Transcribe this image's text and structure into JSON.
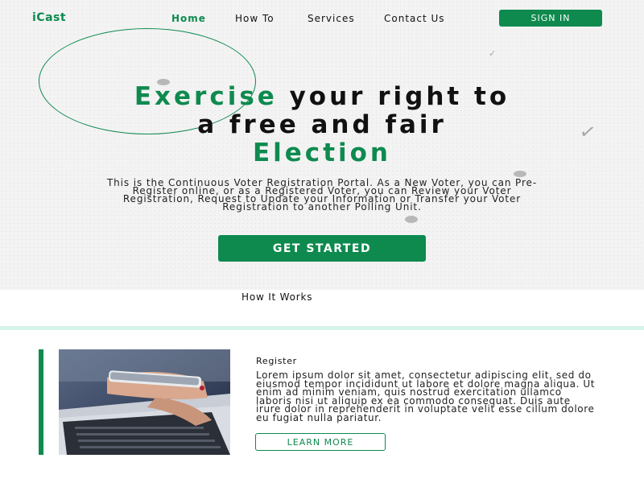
{
  "header": {
    "logo": "iCast",
    "nav": [
      "Home",
      "How To",
      "Services",
      "Contact Us"
    ],
    "active_nav": "Home",
    "signin_label": "SIGN IN"
  },
  "hero": {
    "headline_green_1": "Exercise",
    "headline_dark_1": " your right to",
    "headline_dark_2": "a free and fair",
    "headline_green_2": "Election",
    "description": "This is the Continuous Voter Registration Portal. As a New Voter, you can Pre-Register online, or as a Registered Voter, you can Review your Voter Registration, Request to Update your Information or Transfer your Voter Registration to another Polling Unit.",
    "cta_label": "GET STARTED"
  },
  "how_it_works": {
    "title": "How It Works"
  },
  "card": {
    "title": "Register",
    "body": "Lorem ipsum dolor sit amet, consectetur adipiscing elit, sed do eiusmod tempor incididunt ut labore et dolore magna aliqua. Ut enim ad minim veniam, quis nostrud exercitation ullamco laboris nisi ut aliquip ex ea commodo consequat. Duis aute irure dolor in reprehenderit in voluptate velit esse cillum dolore eu fugiat nulla pariatur.",
    "button_label": "LEARN MORE"
  },
  "colors": {
    "brand_green": "#0e8a4f",
    "band_mint": "#d7f4ec"
  },
  "icons": {
    "decor_check": "checkmark-icon"
  }
}
